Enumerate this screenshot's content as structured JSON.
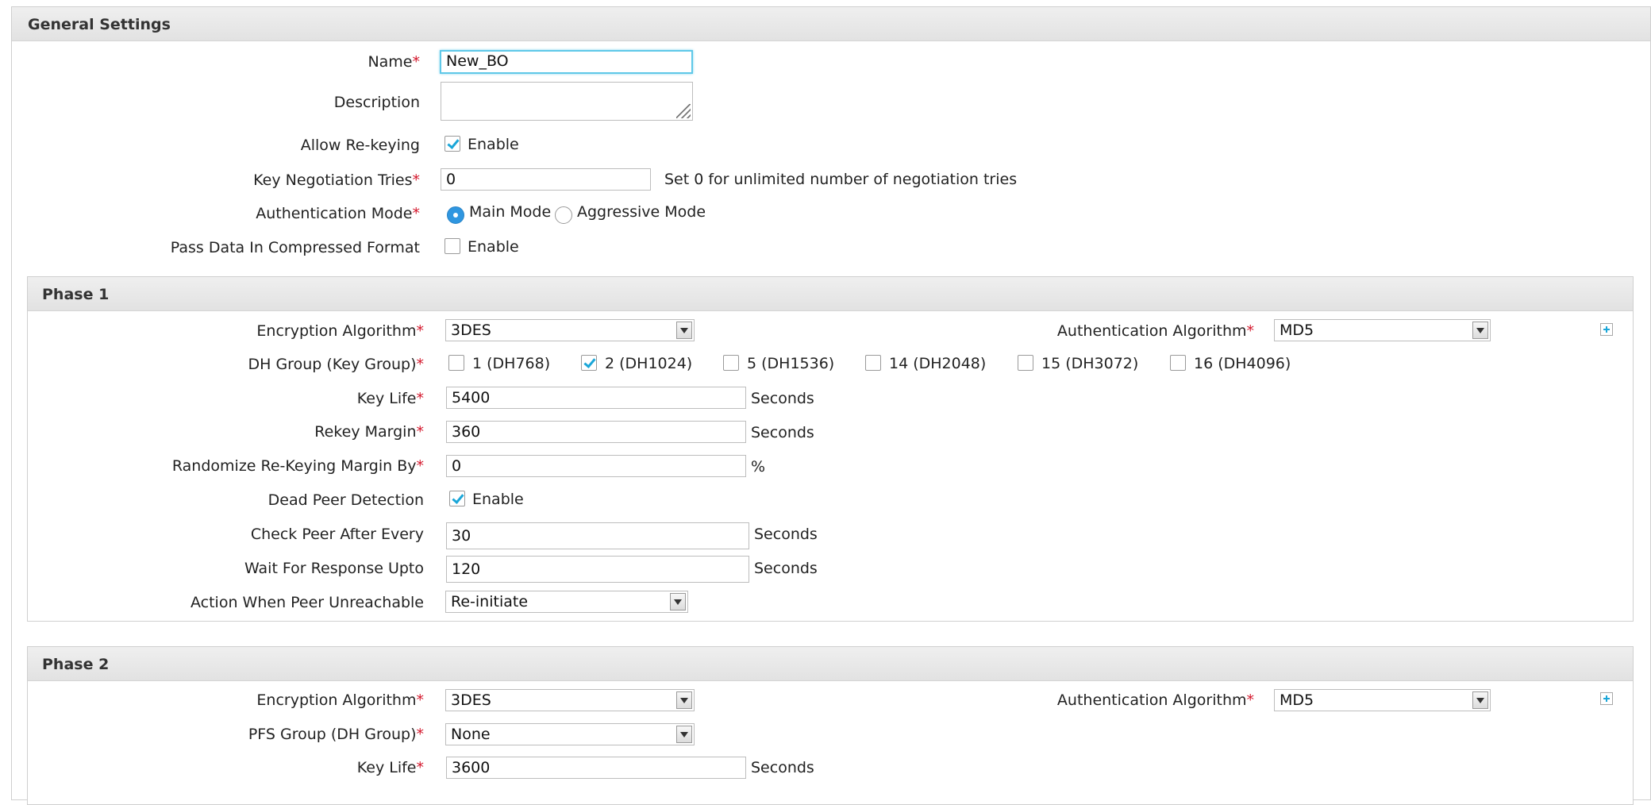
{
  "general": {
    "title": "General Settings",
    "name_label": "Name",
    "name_value": "New_BO",
    "description_label": "Description",
    "allow_rekeying_label": "Allow Re-keying",
    "allow_rekeying_option": "Enable",
    "allow_rekeying_checked": true,
    "key_negotiation_label": "Key Negotiation Tries",
    "key_negotiation_value": "0",
    "key_negotiation_hint": "Set 0 for unlimited number of negotiation tries",
    "auth_mode_label": "Authentication Mode",
    "auth_mode_main": "Main Mode",
    "auth_mode_aggressive": "Aggressive Mode",
    "auth_mode_selected": "Main Mode",
    "compressed_label": "Pass Data In Compressed Format",
    "compressed_option": "Enable",
    "compressed_checked": false
  },
  "phase1": {
    "title": "Phase 1",
    "enc_label": "Encryption Algorithm",
    "enc_value": "3DES",
    "auth_alg_label": "Authentication Algorithm",
    "auth_alg_value": "MD5",
    "dh_label": "DH Group (Key Group)",
    "dh_groups": [
      {
        "label": "1 (DH768)",
        "checked": false
      },
      {
        "label": "2 (DH1024)",
        "checked": true
      },
      {
        "label": "5 (DH1536)",
        "checked": false
      },
      {
        "label": "14 (DH2048)",
        "checked": false
      },
      {
        "label": "15 (DH3072)",
        "checked": false
      },
      {
        "label": "16 (DH4096)",
        "checked": false
      }
    ],
    "key_life_label": "Key Life",
    "key_life_value": "5400",
    "key_life_unit": "Seconds",
    "rekey_margin_label": "Rekey Margin",
    "rekey_margin_value": "360",
    "rekey_margin_unit": "Seconds",
    "randomize_label": "Randomize Re-Keying Margin By",
    "randomize_value": "0",
    "randomize_unit": "%",
    "dpd_label": "Dead Peer Detection",
    "dpd_option": "Enable",
    "dpd_checked": true,
    "check_peer_label": "Check Peer After Every",
    "check_peer_value": "30",
    "check_peer_unit": "Seconds",
    "wait_label": "Wait For Response Upto",
    "wait_value": "120",
    "wait_unit": "Seconds",
    "action_label": "Action When Peer Unreachable",
    "action_value": "Re-initiate"
  },
  "phase2": {
    "title": "Phase 2",
    "enc_label": "Encryption Algorithm",
    "enc_value": "3DES",
    "auth_alg_label": "Authentication Algorithm",
    "auth_alg_value": "MD5",
    "pfs_label": "PFS Group (DH Group)",
    "pfs_value": "None",
    "key_life_label": "Key Life",
    "key_life_value": "3600",
    "key_life_unit": "Seconds"
  },
  "colors": {
    "required": "#d4162b",
    "accent": "#1aa6d8",
    "focus": "#5fc8e8",
    "header_bg": "#e6e6e6"
  }
}
